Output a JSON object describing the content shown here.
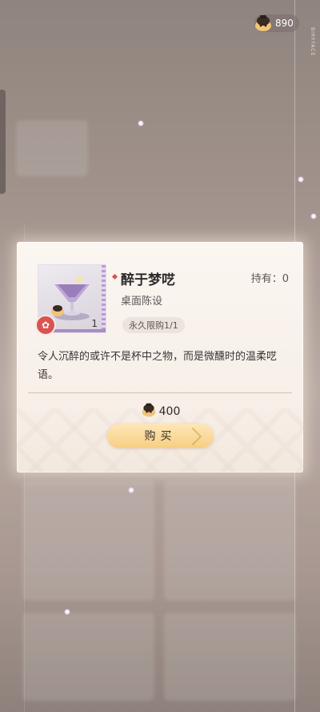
{
  "header": {
    "currency_icon": "pudding-mascot-icon",
    "currency_amount": "890",
    "vertical_label": "BIRYFACE"
  },
  "dialog": {
    "item": {
      "name": "醉于梦呓",
      "category": "桌面陈设",
      "holding": "持有：0",
      "count": "1",
      "limit": "永久限购1/1",
      "rarity_icon": "flower-rarity-icon",
      "image_icon": "cocktail-glass-icon"
    },
    "description": "令人沉醉的或许不是杯中之物，而是微醺时的温柔呓语。",
    "price": {
      "icon": "pudding-mascot-icon",
      "amount": "400"
    },
    "buy_label": "购买"
  },
  "colors": {
    "accent_red": "#d9534f",
    "button_gold": "#f7cf83",
    "rarity_purple": "#a98cc4"
  }
}
